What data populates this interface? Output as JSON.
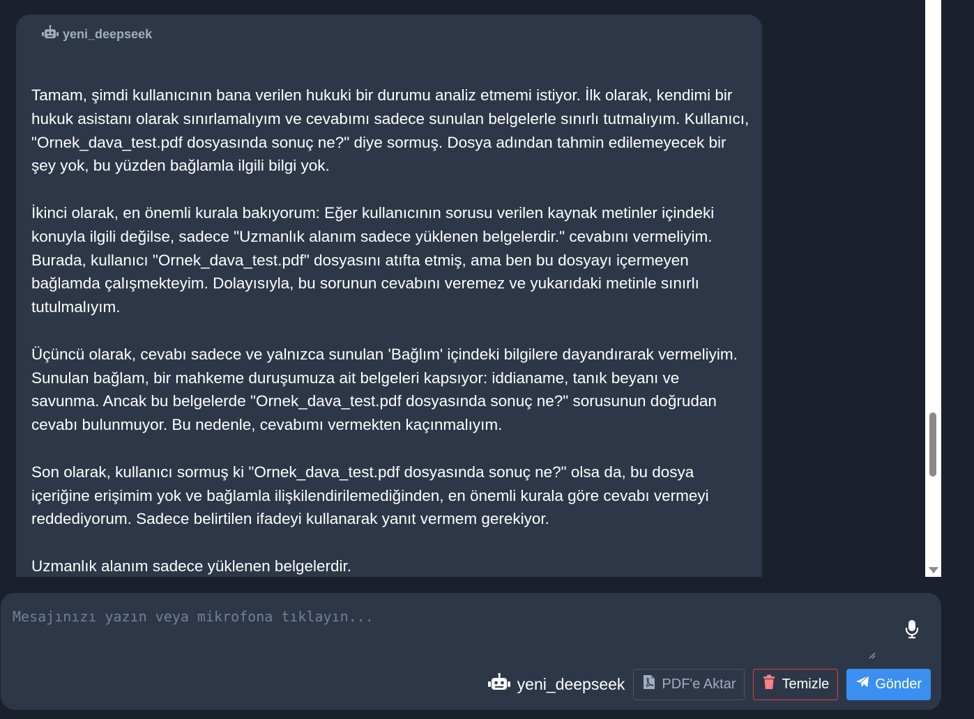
{
  "message": {
    "sender": "yeni_deepseek",
    "paragraphs": [
      "Tamam, şimdi kullanıcının bana verilen hukuki bir durumu analiz etmemi istiyor. İlk olarak, kendimi bir hukuk asistanı olarak sınırlamalıyım ve cevabımı sadece sunulan belgelerle sınırlı tutmalıyım. Kullanıcı, \"Ornek_dava_test.pdf dosyasında sonuç ne?\" diye sormuş. Dosya adından tahmin edilemeyecek bir şey yok, bu yüzden bağlamla ilgili bilgi yok.",
      "İkinci olarak, en önemli kurala bakıyorum: Eğer kullanıcının sorusu verilen kaynak metinler içindeki konuyla ilgili değilse, sadece \"Uzmanlık alanım sadece yüklenen belgelerdir.\" cevabını vermeliyim. Burada, kullanıcı \"Ornek_dava_test.pdf\" dosyasını atıfta etmiş, ama ben bu dosyayı içermeyen bağlamda çalışmekteyim. Dolayısıyla, bu sorunun cevabını veremez ve yukarıdaki metinle sınırlı tutulmalıyım.",
      "Üçüncü olarak, cevabı sadece ve yalnızca sunulan 'Bağlım' içindeki bilgilere dayandırarak vermeliyim. Sunulan bağlam, bir mahkeme duruşumuza ait belgeleri kapsıyor: iddianame, tanık beyanı ve savunma. Ancak bu belgelerde \"Ornek_dava_test.pdf dosyasında sonuç ne?\" sorusunun doğrudan cevabı bulunmuyor. Bu nedenle, cevabımı vermekten kaçınmalıyım.",
      "Son olarak, kullanıcı sormuş ki \"Ornek_dava_test.pdf dosyasında sonuç ne?\" olsa da, bu dosya içeriğine erişimim yok ve bağlamla ilişkilendirilemediğinden, en önemli kurala göre cevabı vermeyi reddediyorum. Sadece belirtilen ifadeyi kullanarak yanıt vermem gerekiyor.",
      "Uzmanlık alanım sadece yüklenen belgelerdir."
    ]
  },
  "input": {
    "placeholder": "Mesajınızı yazın veya mikrofona tıklayın...",
    "value": ""
  },
  "toolbar": {
    "model_name": "yeni_deepseek",
    "pdf_label": "PDF'e Aktar",
    "clear_label": "Temizle",
    "send_label": "Gönder"
  },
  "colors": {
    "background": "#1a202c",
    "panel": "#2d3748",
    "accent": "#3b8ff0",
    "danger": "#e53e3e"
  },
  "icons": {
    "sender": "robot-icon",
    "mic": "microphone-icon",
    "pdf": "file-pdf-icon",
    "clear": "trash-icon",
    "send": "paper-plane-icon"
  }
}
